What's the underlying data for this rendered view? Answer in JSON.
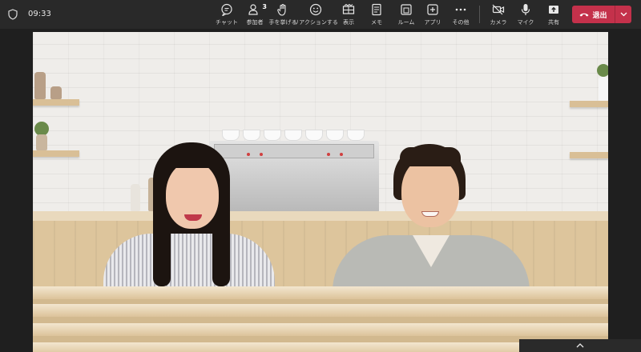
{
  "meeting": {
    "elapsed_time": "09:33"
  },
  "toolbar": {
    "chat_label": "チャット",
    "participants_label": "参加者",
    "participants_count": "3",
    "raise_hand_label": "手を挙げる",
    "reactions_label": "リアクションする",
    "view_label": "表示",
    "notes_label": "メモ",
    "rooms_label": "ルーム",
    "apps_label": "アプリ",
    "more_label": "その他",
    "camera_label": "カメラ",
    "mic_label": "マイク",
    "share_label": "共有",
    "leave_label": "退出"
  },
  "colors": {
    "toolbar_bg": "#292929",
    "leave_red": "#c4314b",
    "page_bg": "#1f1f1f"
  },
  "icons": {
    "security": "shield-icon",
    "chat": "chat-icon",
    "participants": "people-icon",
    "raise_hand": "hand-icon",
    "reactions": "smiley-icon",
    "view": "grid-view-icon",
    "notes": "notes-icon",
    "rooms": "rooms-icon",
    "apps": "apps-plus-icon",
    "more": "more-dots-icon",
    "camera": "camera-off-icon",
    "mic": "mic-icon",
    "share": "share-tray-icon",
    "leave": "phone-hangup-icon",
    "leave_options": "chevron-down-icon",
    "bottom": "chevron-up-icon"
  }
}
